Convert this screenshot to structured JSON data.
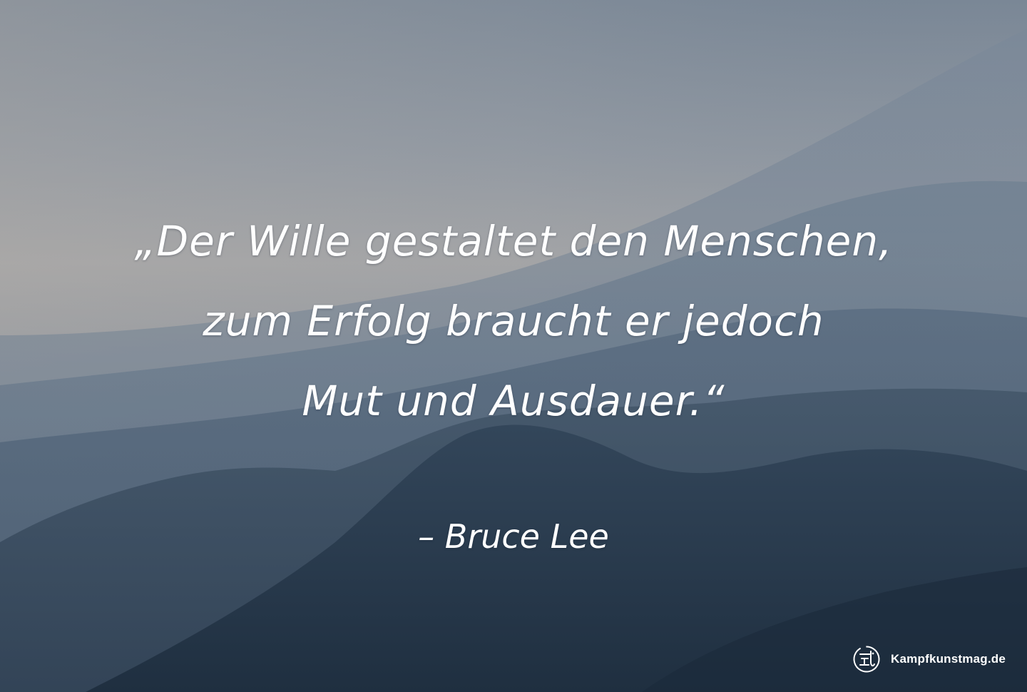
{
  "quote": {
    "lines": [
      "„Der Wille gestaltet den Menschen,",
      "zum Erfolg braucht er jedoch",
      "Mut und Ausdauer.“"
    ]
  },
  "author": "– Bruce Lee",
  "watermark": {
    "site": "Kampfkunstmag.de",
    "icon": "martial-arts-logo-icon"
  },
  "colors": {
    "text": "#ffffff",
    "sky_top": "#7d8a99",
    "sky_haze": "#a3a4a6",
    "mountain_dark": "#2c3e52"
  }
}
